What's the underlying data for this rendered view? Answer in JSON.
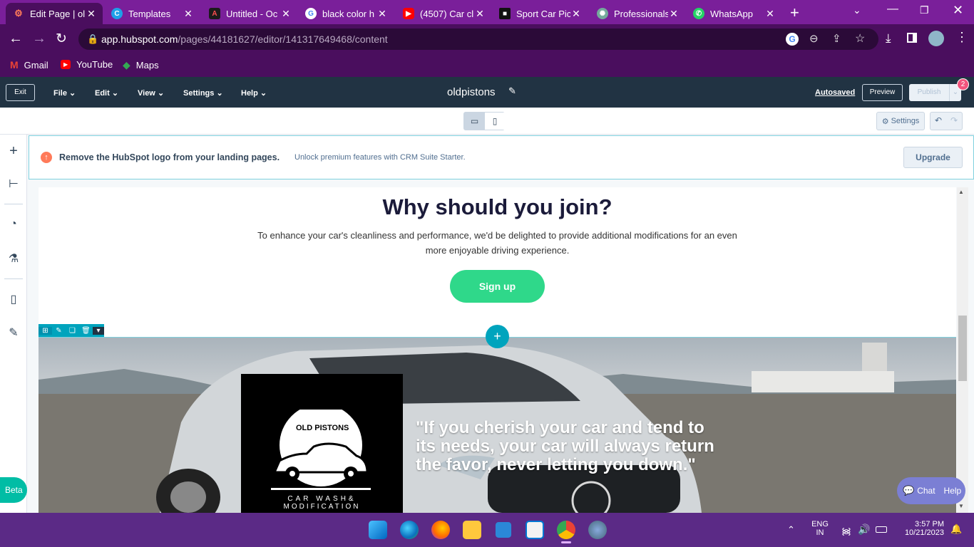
{
  "tabs": [
    {
      "title": "Edit Page | ol",
      "icon": "hubspot-icon",
      "active": true
    },
    {
      "title": "Templates",
      "icon": "canva-icon"
    },
    {
      "title": "Untitled - Oc",
      "icon": "adobe-express-icon"
    },
    {
      "title": "black color h",
      "icon": "google-icon"
    },
    {
      "title": "(4507) Car cl",
      "icon": "youtube-icon"
    },
    {
      "title": "Sport Car Pic",
      "icon": "unsplash-icon"
    },
    {
      "title": "Professionals",
      "icon": "chatgpt-icon"
    },
    {
      "title": "WhatsApp",
      "icon": "whatsapp-icon"
    }
  ],
  "url": {
    "host": "app.hubspot.com",
    "path": "/pages/44181627/editor/141317649468/content"
  },
  "bookmarks": [
    {
      "label": "Gmail",
      "icon": "gmail-icon"
    },
    {
      "label": "YouTube",
      "icon": "youtube-icon"
    },
    {
      "label": "Maps",
      "icon": "maps-icon"
    }
  ],
  "editor": {
    "exit": "Exit",
    "menus": [
      "File",
      "Edit",
      "View",
      "Settings",
      "Help"
    ],
    "page_name": "oldpistons",
    "autosaved": "Autosaved",
    "preview": "Preview",
    "publish": "Publish",
    "notification_count": "2",
    "settings": "Settings"
  },
  "banner": {
    "headline": "Remove the HubSpot logo from your landing pages.",
    "sub": "Unlock premium features with CRM Suite Starter.",
    "button": "Upgrade"
  },
  "content": {
    "heading": "Why should you join?",
    "body": "To enhance your car's cleanliness and performance, we'd be delighted to provide additional modifications for an even more enjoyable driving experience.",
    "signup": "Sign up",
    "logo_text": "OLD PISTONS",
    "logo_sub1": "CAR WASH&",
    "logo_sub2": "MODIFICATION",
    "quote": "\"If you cherish your car and tend to its needs, your car will always return the favor, never letting you down.\""
  },
  "widgets": {
    "beta": "Beta",
    "chat": "Chat",
    "help": "Help"
  },
  "taskbar": {
    "lang1": "ENG",
    "lang2": "IN",
    "time": "3:57 PM",
    "date": "10/21/2023"
  },
  "colors": {
    "signup": "#2fd88a",
    "hubspot_nav": "#213343",
    "chrome_tab": "#7a1f9a",
    "accent_teal": "#00a4bd"
  }
}
